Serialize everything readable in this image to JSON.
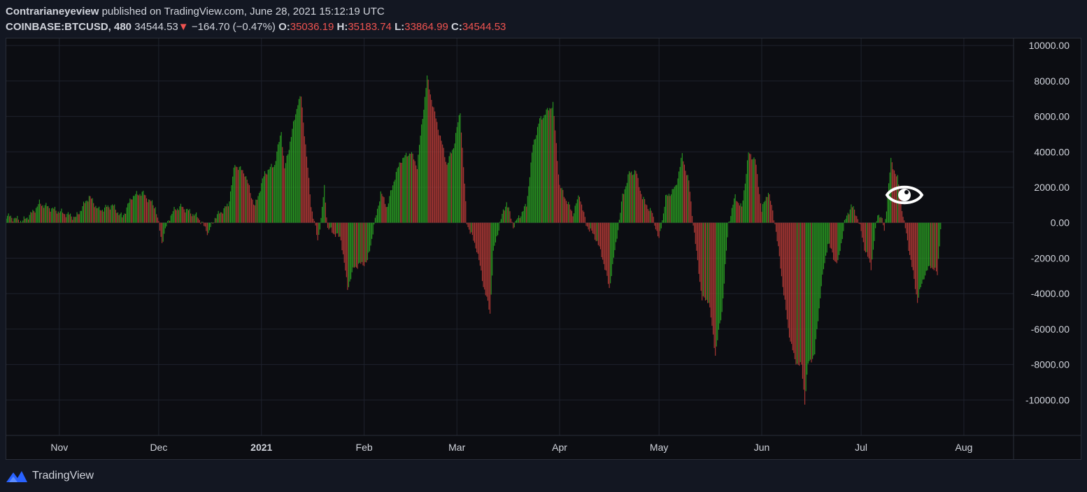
{
  "header": {
    "author": "Contrarianeyeview",
    "published_text": "published on TradingView.com, June 28, 2021 15:12:19 UTC",
    "symbol": "COINBASE:BTCUSD, 480",
    "last_price": "34544.53",
    "change_arrow": "▼",
    "change": "−164.70 (−0.47%)",
    "open_label": "O:",
    "open": "35036.19",
    "high_label": "H:",
    "high": "35183.74",
    "low_label": "L:",
    "low": "33864.99",
    "close_label": "C:",
    "close": "34544.53"
  },
  "footer": {
    "brand": "TradingView",
    "logo_icon": "tradingview-logo-icon"
  },
  "colors": {
    "background": "#131722",
    "plot_background": "#0c0d12",
    "grid": "#1e222d",
    "text": "#d1d4dc",
    "up": "#26a625",
    "down": "#ef5350",
    "bar_red": "#b33a36",
    "bar_green": "#2a9d22",
    "logo_blue": "#2962ff"
  },
  "chart_data": {
    "type": "bar",
    "title": "",
    "xlabel": "",
    "ylabel": "",
    "ylim": [
      -12000,
      10400
    ],
    "y_ticks": [
      "10000.00",
      "8000.00",
      "6000.00",
      "4000.00",
      "2000.00",
      "0.00",
      "-2000.00",
      "-4000.00",
      "-6000.00",
      "-8000.00",
      "-10000.00"
    ],
    "x_ticks": [
      "Nov",
      "Dec",
      "2021",
      "Feb",
      "Mar",
      "Apr",
      "May",
      "Jun",
      "Jul",
      "Aug"
    ],
    "x_range": [
      "2020-10-16",
      "2021-08-16"
    ],
    "grid": true,
    "bar_interval_hours": 8,
    "series_keypoints": [
      [
        "2020-10-16",
        400
      ],
      [
        "2020-10-21",
        100
      ],
      [
        "2020-10-24",
        600
      ],
      [
        "2020-10-26",
        1100
      ],
      [
        "2020-10-31",
        700
      ],
      [
        "2020-11-03",
        500
      ],
      [
        "2020-11-06",
        300
      ],
      [
        "2020-11-10",
        1500
      ],
      [
        "2020-11-13",
        700
      ],
      [
        "2020-11-17",
        1000
      ],
      [
        "2020-11-20",
        300
      ],
      [
        "2020-11-23",
        1500
      ],
      [
        "2020-11-26",
        1700
      ],
      [
        "2020-11-30",
        900
      ],
      [
        "2020-12-02",
        -1100
      ],
      [
        "2020-12-04",
        200
      ],
      [
        "2020-12-06",
        800
      ],
      [
        "2020-12-08",
        900
      ],
      [
        "2020-12-13",
        300
      ],
      [
        "2020-12-16",
        -600
      ],
      [
        "2020-12-18",
        300
      ],
      [
        "2020-12-22",
        1000
      ],
      [
        "2020-12-24",
        3300
      ],
      [
        "2020-12-27",
        2800
      ],
      [
        "2020-12-30",
        900
      ],
      [
        "2021-01-02",
        2800
      ],
      [
        "2021-01-05",
        3300
      ],
      [
        "2021-01-07",
        5200
      ],
      [
        "2021-01-08",
        3000
      ],
      [
        "2021-01-12",
        6800
      ],
      [
        "2021-01-13",
        7100
      ],
      [
        "2021-01-16",
        1000
      ],
      [
        "2021-01-18",
        -1000
      ],
      [
        "2021-01-19",
        200
      ],
      [
        "2021-01-20",
        2000
      ],
      [
        "2021-01-21",
        -300
      ],
      [
        "2021-01-25",
        -900
      ],
      [
        "2021-01-27",
        -3700
      ],
      [
        "2021-01-29",
        -2500
      ],
      [
        "2021-02-02",
        -2200
      ],
      [
        "2021-02-04",
        -200
      ],
      [
        "2021-02-06",
        1700
      ],
      [
        "2021-02-08",
        900
      ],
      [
        "2021-02-10",
        2400
      ],
      [
        "2021-02-12",
        3500
      ],
      [
        "2021-02-15",
        4000
      ],
      [
        "2021-02-17",
        3200
      ],
      [
        "2021-02-20",
        8200
      ],
      [
        "2021-02-22",
        6400
      ],
      [
        "2021-02-26",
        3300
      ],
      [
        "2021-02-28",
        4300
      ],
      [
        "2021-03-02",
        6300
      ],
      [
        "2021-03-04",
        0
      ],
      [
        "2021-03-07",
        -1500
      ],
      [
        "2021-03-09",
        -3500
      ],
      [
        "2021-03-11",
        -5100
      ],
      [
        "2021-03-12",
        -1700
      ],
      [
        "2021-03-14",
        0
      ],
      [
        "2021-03-16",
        1200
      ],
      [
        "2021-03-18",
        -200
      ],
      [
        "2021-03-22",
        1000
      ],
      [
        "2021-03-24",
        4400
      ],
      [
        "2021-03-26",
        5800
      ],
      [
        "2021-03-30",
        6700
      ],
      [
        "2021-04-01",
        2100
      ],
      [
        "2021-04-05",
        500
      ],
      [
        "2021-04-07",
        1600
      ],
      [
        "2021-04-09",
        -100
      ],
      [
        "2021-04-12",
        -900
      ],
      [
        "2021-04-14",
        -2000
      ],
      [
        "2021-04-16",
        -3700
      ],
      [
        "2021-04-18",
        -1200
      ],
      [
        "2021-04-20",
        1500
      ],
      [
        "2021-04-22",
        2800
      ],
      [
        "2021-04-24",
        2900
      ],
      [
        "2021-04-26",
        1400
      ],
      [
        "2021-04-29",
        500
      ],
      [
        "2021-05-01",
        -1000
      ],
      [
        "2021-05-03",
        1400
      ],
      [
        "2021-05-06",
        2000
      ],
      [
        "2021-05-08",
        3800
      ],
      [
        "2021-05-10",
        2300
      ],
      [
        "2021-05-12",
        -1200
      ],
      [
        "2021-05-14",
        -4300
      ],
      [
        "2021-05-16",
        -4400
      ],
      [
        "2021-05-18",
        -7400
      ],
      [
        "2021-05-20",
        -5000
      ],
      [
        "2021-05-22",
        0
      ],
      [
        "2021-05-24",
        1500
      ],
      [
        "2021-05-26",
        800
      ],
      [
        "2021-05-28",
        3900
      ],
      [
        "2021-05-30",
        3600
      ],
      [
        "2021-06-01",
        700
      ],
      [
        "2021-06-03",
        1800
      ],
      [
        "2021-06-05",
        0
      ],
      [
        "2021-06-07",
        -3000
      ],
      [
        "2021-06-09",
        -6000
      ],
      [
        "2021-06-11",
        -7800
      ],
      [
        "2021-06-13",
        -8100
      ],
      [
        "2021-06-14",
        -10100
      ],
      [
        "2021-06-15",
        -8000
      ],
      [
        "2021-06-17",
        -7400
      ],
      [
        "2021-06-19",
        -3500
      ],
      [
        "2021-06-21",
        -1100
      ],
      [
        "2021-06-23",
        -2100
      ],
      [
        "2021-06-24",
        -2300
      ],
      [
        "2021-06-26",
        0
      ],
      [
        "2021-06-27",
        500
      ],
      [
        "2021-06-28",
        1000
      ],
      [
        "2021-06-30",
        300
      ],
      [
        "2021-07-02",
        -1400
      ],
      [
        "2021-07-04",
        -2500
      ],
      [
        "2021-07-06",
        500
      ],
      [
        "2021-07-07",
        400
      ],
      [
        "2021-07-08",
        -500
      ],
      [
        "2021-07-10",
        3500
      ],
      [
        "2021-07-12",
        2500
      ],
      [
        "2021-07-14",
        0
      ],
      [
        "2021-07-16",
        -2100
      ],
      [
        "2021-07-18",
        -4400
      ],
      [
        "2021-07-20",
        -3000
      ],
      [
        "2021-07-22",
        -2400
      ],
      [
        "2021-07-24",
        -2900
      ],
      [
        "2021-07-25",
        -300
      ]
    ]
  }
}
